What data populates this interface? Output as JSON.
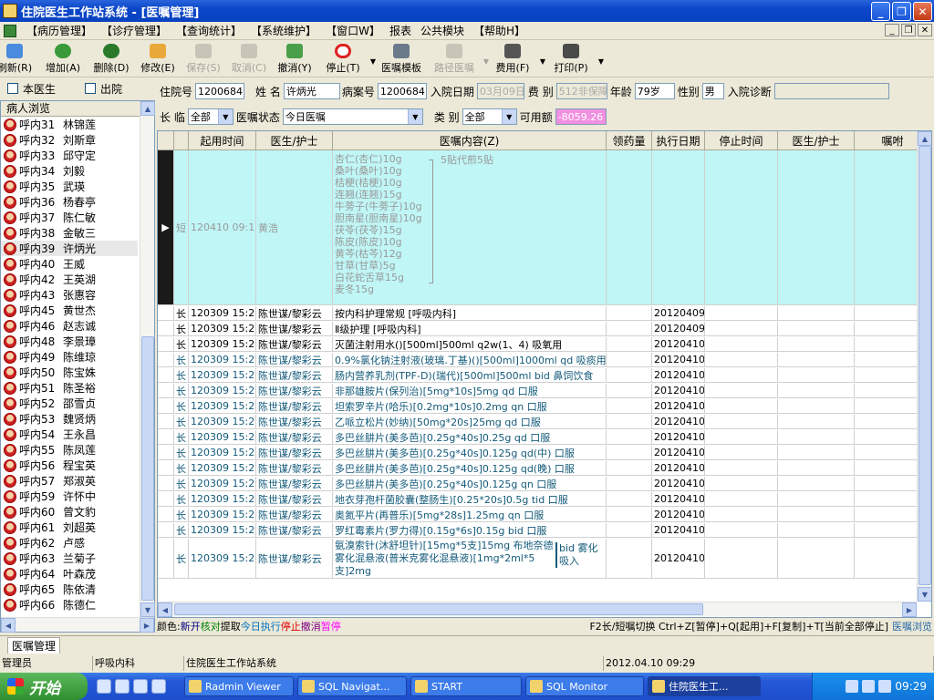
{
  "window": {
    "title": "住院医生工作站系统 - [医嘱管理]"
  },
  "menu": [
    "【病历管理】",
    "【诊疗管理】",
    "【查询统计】",
    "【系统维护】",
    "【窗口W】",
    "报表",
    "公共模块",
    "【帮助H】"
  ],
  "toolbar": [
    {
      "label": "刷新(R)",
      "icon": "refresh-icon",
      "enabled": true
    },
    {
      "label": "增加(A)",
      "icon": "add-icon",
      "enabled": true
    },
    {
      "label": "删除(D)",
      "icon": "delete-icon",
      "enabled": true
    },
    {
      "label": "修改(E)",
      "icon": "edit-icon",
      "enabled": true
    },
    {
      "label": "保存(S)",
      "icon": "save-icon",
      "enabled": false
    },
    {
      "label": "取消(C)",
      "icon": "cancel-icon",
      "enabled": false
    },
    {
      "label": "撤消(Y)",
      "icon": "undo-icon",
      "enabled": true
    },
    {
      "label": "停止(T)",
      "icon": "stop-icon",
      "enabled": true
    },
    {
      "label": "医嘱模板",
      "icon": "template-icon",
      "enabled": true
    },
    {
      "label": "路径医嘱",
      "icon": "path-icon",
      "enabled": false
    },
    {
      "label": "费用(F)",
      "icon": "fee-icon",
      "enabled": true
    },
    {
      "label": "打印(P)",
      "icon": "print-icon",
      "enabled": true
    }
  ],
  "filters": {
    "this_doctor": "本医生",
    "discharged": "出院"
  },
  "patient_panel": {
    "header": "病人浏览"
  },
  "patients": [
    {
      "bed": "呼内31",
      "name": "林锦莲"
    },
    {
      "bed": "呼内32",
      "name": "刘斯章"
    },
    {
      "bed": "呼内33",
      "name": "邱守定"
    },
    {
      "bed": "呼内34",
      "name": "刘毅"
    },
    {
      "bed": "呼内35",
      "name": "武瑛"
    },
    {
      "bed": "呼内36",
      "name": "杨春亭"
    },
    {
      "bed": "呼内37",
      "name": "陈仁敏"
    },
    {
      "bed": "呼内38",
      "name": "金敏三"
    },
    {
      "bed": "呼内39",
      "name": "许炳光"
    },
    {
      "bed": "呼内40",
      "name": "王威"
    },
    {
      "bed": "呼内42",
      "name": "王英湖"
    },
    {
      "bed": "呼内43",
      "name": "张惠容"
    },
    {
      "bed": "呼内45",
      "name": "黄世杰"
    },
    {
      "bed": "呼内46",
      "name": "赵志诚"
    },
    {
      "bed": "呼内48",
      "name": "李景璋"
    },
    {
      "bed": "呼内49",
      "name": "陈维琼"
    },
    {
      "bed": "呼内50",
      "name": "陈宝姝"
    },
    {
      "bed": "呼内51",
      "name": "陈圣裕"
    },
    {
      "bed": "呼内52",
      "name": "邵雪贞"
    },
    {
      "bed": "呼内53",
      "name": "魏贤炳"
    },
    {
      "bed": "呼内54",
      "name": "王永昌"
    },
    {
      "bed": "呼内55",
      "name": "陈凤莲"
    },
    {
      "bed": "呼内56",
      "name": "程宝英"
    },
    {
      "bed": "呼内57",
      "name": "郑淑英"
    },
    {
      "bed": "呼内59",
      "name": "许怀中"
    },
    {
      "bed": "呼内60",
      "name": "曾文豹"
    },
    {
      "bed": "呼内61",
      "name": "刘超英"
    },
    {
      "bed": "呼内62",
      "name": "卢感"
    },
    {
      "bed": "呼内63",
      "name": "兰菊子"
    },
    {
      "bed": "呼内64",
      "name": "叶森茂"
    },
    {
      "bed": "呼内65",
      "name": "陈依清"
    },
    {
      "bed": "呼内66",
      "name": "陈德仁"
    }
  ],
  "patient_info": {
    "admission_no_label": "住院号",
    "admission_no": "1200684",
    "name_label": "姓 名",
    "name": "许炳光",
    "case_no_label": "病案号",
    "case_no": "1200684",
    "admit_date_label": "入院日期",
    "admit_date": "03月09日",
    "fee_type_label": "费 别",
    "fee_type": "512非保障",
    "age_label": "年龄",
    "age": "79岁",
    "sex_label": "性别",
    "sex": "男",
    "diagnosis_label": "入院诊断",
    "diagnosis": ""
  },
  "order_filter": {
    "longtemp_label": "长 临",
    "longtemp_value": "全部",
    "status_label": "医嘱状态",
    "status_value": "今日医嘱",
    "class_label": "类 别",
    "class_value": "全部",
    "balance_label": "可用额",
    "balance_value": "-8059.26"
  },
  "grid": {
    "columns": [
      "起用时间",
      "医生/护士",
      "医嘱内容(Z)",
      "领药量",
      "执行日期",
      "停止时间",
      "医生/护士",
      "嘱咐"
    ],
    "first_order": {
      "type": "短",
      "start": "120410 09:15",
      "doctor": "黄浩",
      "herbs": [
        "杏仁(杏仁)10g",
        "桑叶(桑叶)10g",
        "桔梗(桔梗)10g",
        "连翘(连翘)15g",
        "牛蒡子(牛蒡子)10g",
        "胆南星(胆南星)10g",
        "茯苓(茯苓)15g",
        "陈皮(陈皮)10g",
        "黄芩(枯芩)12g",
        "甘草(甘草)5g",
        "白花蛇舌草15g",
        "麦冬15g"
      ],
      "note": "5贴代煎5贴"
    },
    "rows": [
      {
        "type": "长",
        "start": "120309 15:25",
        "doctor": "陈世谋/黎彩云",
        "content": "按内科护理常规 [呼吸内科]",
        "exec": "20120409",
        "color": "black"
      },
      {
        "type": "长",
        "start": "120309 15:25",
        "doctor": "陈世谋/黎彩云",
        "content": "Ⅱ级护理 [呼吸内科]",
        "exec": "20120409",
        "color": "black"
      },
      {
        "type": "长",
        "start": "120309 15:25",
        "doctor": "陈世谋/黎彩云",
        "content": "灭菌注射用水()[500ml]500ml q2w(1、4) 吸氧用",
        "exec": "20120410",
        "color": "black"
      },
      {
        "type": "长",
        "start": "120309 15:25",
        "doctor": "陈世谋/黎彩云",
        "content": "0.9%氯化钠注射液(玻璃.丁基)()[500ml]1000ml qd 吸痰用",
        "exec": "20120410",
        "color": "teal"
      },
      {
        "type": "长",
        "start": "120309 15:25",
        "doctor": "陈世谋/黎彩云",
        "content": "肠内营养乳剂(TPF-D)(瑞代)[500ml]500ml bid 鼻饲饮食",
        "exec": "20120410",
        "color": "teal"
      },
      {
        "type": "长",
        "start": "120309 15:25",
        "doctor": "陈世谋/黎彩云",
        "content": "非那雄胺片(保列治)[5mg*10s]5mg qd 口服",
        "exec": "20120410",
        "color": "teal"
      },
      {
        "type": "长",
        "start": "120309 15:25",
        "doctor": "陈世谋/黎彩云",
        "content": "坦索罗辛片(哈乐)[0.2mg*10s]0.2mg qn 口服",
        "exec": "20120410",
        "color": "teal"
      },
      {
        "type": "长",
        "start": "120309 15:25",
        "doctor": "陈世谋/黎彩云",
        "content": "乙哌立松片(妙纳)[50mg*20s]25mg qd 口服",
        "exec": "20120410",
        "color": "teal"
      },
      {
        "type": "长",
        "start": "120309 15:25",
        "doctor": "陈世谋/黎彩云",
        "content": "多巴丝肼片(美多芭)[0.25g*40s]0.25g qd 口服",
        "exec": "20120410",
        "color": "teal"
      },
      {
        "type": "长",
        "start": "120309 15:25",
        "doctor": "陈世谋/黎彩云",
        "content": "多巴丝肼片(美多芭)[0.25g*40s]0.125g qd(中) 口服",
        "exec": "20120410",
        "color": "teal"
      },
      {
        "type": "长",
        "start": "120309 15:25",
        "doctor": "陈世谋/黎彩云",
        "content": "多巴丝肼片(美多芭)[0.25g*40s]0.125g qd(晚) 口服",
        "exec": "20120410",
        "color": "teal"
      },
      {
        "type": "长",
        "start": "120309 15:25",
        "doctor": "陈世谋/黎彩云",
        "content": "多巴丝肼片(美多芭)[0.25g*40s]0.125g qn 口服",
        "exec": "20120410",
        "color": "teal"
      },
      {
        "type": "长",
        "start": "120309 15:25",
        "doctor": "陈世谋/黎彩云",
        "content": "地衣芽孢杆菌胶囊(整肠生)[0.25*20s]0.5g tid 口服",
        "exec": "20120410",
        "color": "teal"
      },
      {
        "type": "长",
        "start": "120309 15:25",
        "doctor": "陈世谋/黎彩云",
        "content": "奥氮平片(再普乐)[5mg*28s]1.25mg qn 口服",
        "exec": "20120410",
        "color": "teal"
      },
      {
        "type": "长",
        "start": "120309 15:25",
        "doctor": "陈世谋/黎彩云",
        "content": "罗红霉素片(罗力得)[0.15g*6s]0.15g bid 口服",
        "exec": "20120410",
        "color": "teal"
      },
      {
        "type": "长",
        "start": "120309 15:25",
        "doctor": "陈世谋/黎彩云",
        "content": "氨溴索针(沐舒坦针)[15mg*5支]15mg 布地奈德雾化混悬液(普米克雾化混悬液)[1mg*2ml*5支]2mg",
        "note": "bid 雾化吸入",
        "exec": "20120410",
        "color": "teal"
      }
    ]
  },
  "legend": {
    "prefix": "颜色:",
    "items": [
      {
        "text": "新开",
        "color": "#000080"
      },
      {
        "text": "核对",
        "color": "#008000"
      },
      {
        "text": "提取",
        "color": "#000000"
      },
      {
        "text": "今日执行",
        "color": "#0070c0"
      },
      {
        "text": "停止",
        "color": "#e00000"
      },
      {
        "text": "撤消",
        "color": "#800080"
      },
      {
        "text": "暂停",
        "color": "#ff00ff"
      }
    ],
    "shortcuts": "F2长/短嘱切换 Ctrl+Z[暂停]+Q[起用]+F[复制]+T[当前全部停止]",
    "browse": "医嘱浏览"
  },
  "bottom_tab": "医嘱管理",
  "status": {
    "user": "管理员",
    "dept": "呼吸内科",
    "system": "住院医生工作站系统",
    "datetime": "2012.04.10 09:29"
  },
  "taskbar": {
    "start": "开始",
    "tasks": [
      "Radmin Viewer",
      "SQL Navigat...",
      "START",
      "SQL Monitor",
      "住院医生工..."
    ],
    "clock": "09:29"
  }
}
